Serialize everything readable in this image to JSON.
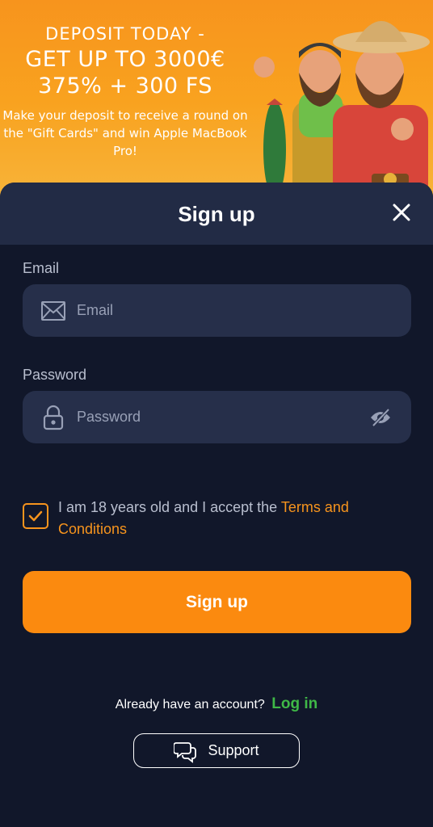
{
  "promo": {
    "line1": "DEPOSIT TODAY -",
    "line2": "GET UP TO 3000€",
    "line3": "375% + 300 FS",
    "description": "Make your deposit to receive a round on the \"Gift Cards\" and win Apple MacBook Pro!"
  },
  "modal": {
    "title": "Sign up",
    "close_icon": "close-icon"
  },
  "form": {
    "email_label": "Email",
    "email_placeholder": "Email",
    "email_value": "",
    "password_label": "Password",
    "password_placeholder": "Password",
    "password_value": "",
    "terms_checked": true,
    "terms_text": "I am 18 years old and I accept the",
    "terms_link": "Terms and Conditions",
    "submit_label": "Sign up"
  },
  "footer": {
    "have_account": "Already have an account?",
    "login_label": "Log in",
    "support_label": "Support"
  },
  "colors": {
    "accent": "#fb8a0f",
    "background": "#11172a",
    "header": "#222b45",
    "field": "#262f4a",
    "login": "#3fb847"
  }
}
